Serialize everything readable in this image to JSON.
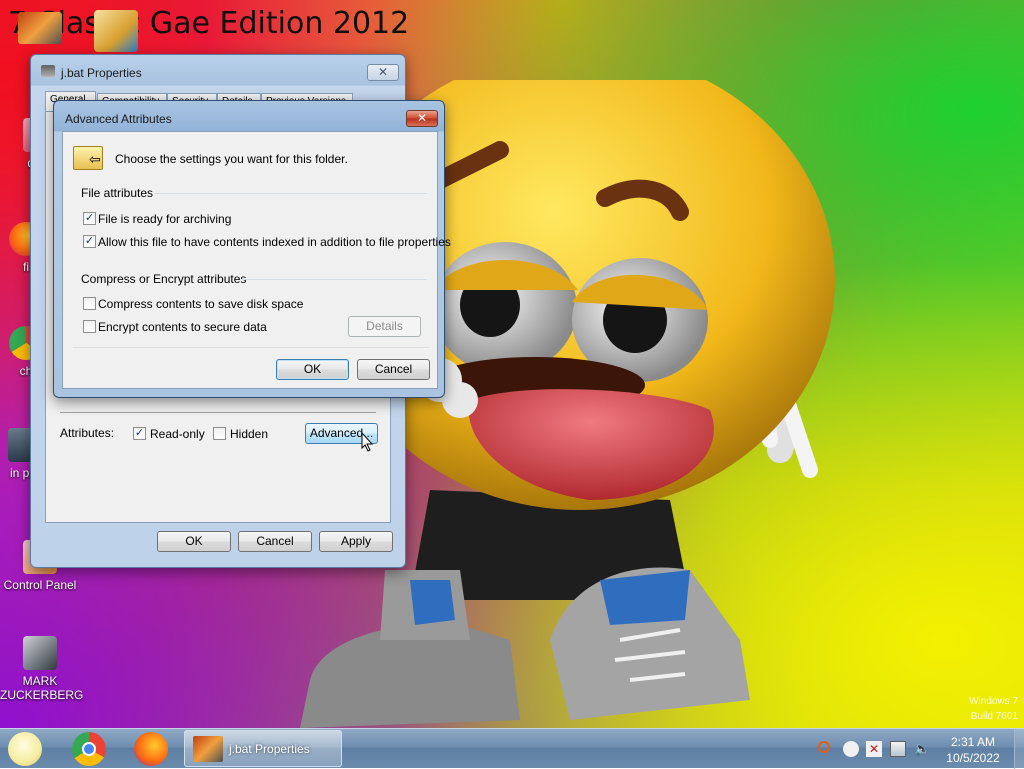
{
  "desktop": {
    "title": "7 Classic Gae Edition 2012",
    "icons": [
      {
        "label": "desk"
      },
      {
        "label": "fi"
      },
      {
        "label": "ch"
      },
      {
        "label": "in pre"
      },
      {
        "label": "Control Panel"
      },
      {
        "label": "MARK ZUCKERBERG"
      }
    ],
    "watermark_line1": "Windows 7",
    "watermark_line2": "Build 7601"
  },
  "properties_window": {
    "title": "j.bat Properties",
    "tabs": [
      "General",
      "Compatibility",
      "Security",
      "Details",
      "Previous Versions"
    ],
    "attributes_label": "Attributes:",
    "readonly_label": "Read-only",
    "readonly_checked": true,
    "hidden_label": "Hidden",
    "hidden_checked": false,
    "advanced_label": "Advanced...",
    "ok_label": "OK",
    "cancel_label": "Cancel",
    "apply_label": "Apply"
  },
  "advanced_dialog": {
    "title": "Advanced Attributes",
    "close_label": "✕",
    "description": "Choose the settings you want for this folder.",
    "file_attributes_heading": "File attributes",
    "archiving_label": "File is ready for archiving",
    "archiving_checked": true,
    "indexed_label": "Allow this file to have contents indexed in addition to file properties",
    "indexed_checked": true,
    "compress_heading": "Compress or Encrypt attributes",
    "compress_label": "Compress contents to save disk space",
    "compress_checked": false,
    "encrypt_label": "Encrypt contents to secure data",
    "encrypt_checked": false,
    "details_label": "Details",
    "ok_label": "OK",
    "cancel_label": "Cancel"
  },
  "taskbar": {
    "task_label": "j.bat Properties",
    "time": "2:31 AM",
    "date": "10/5/2022"
  },
  "colors": {
    "accent": "#3c7fb1",
    "close_red": "#cc4a30"
  }
}
